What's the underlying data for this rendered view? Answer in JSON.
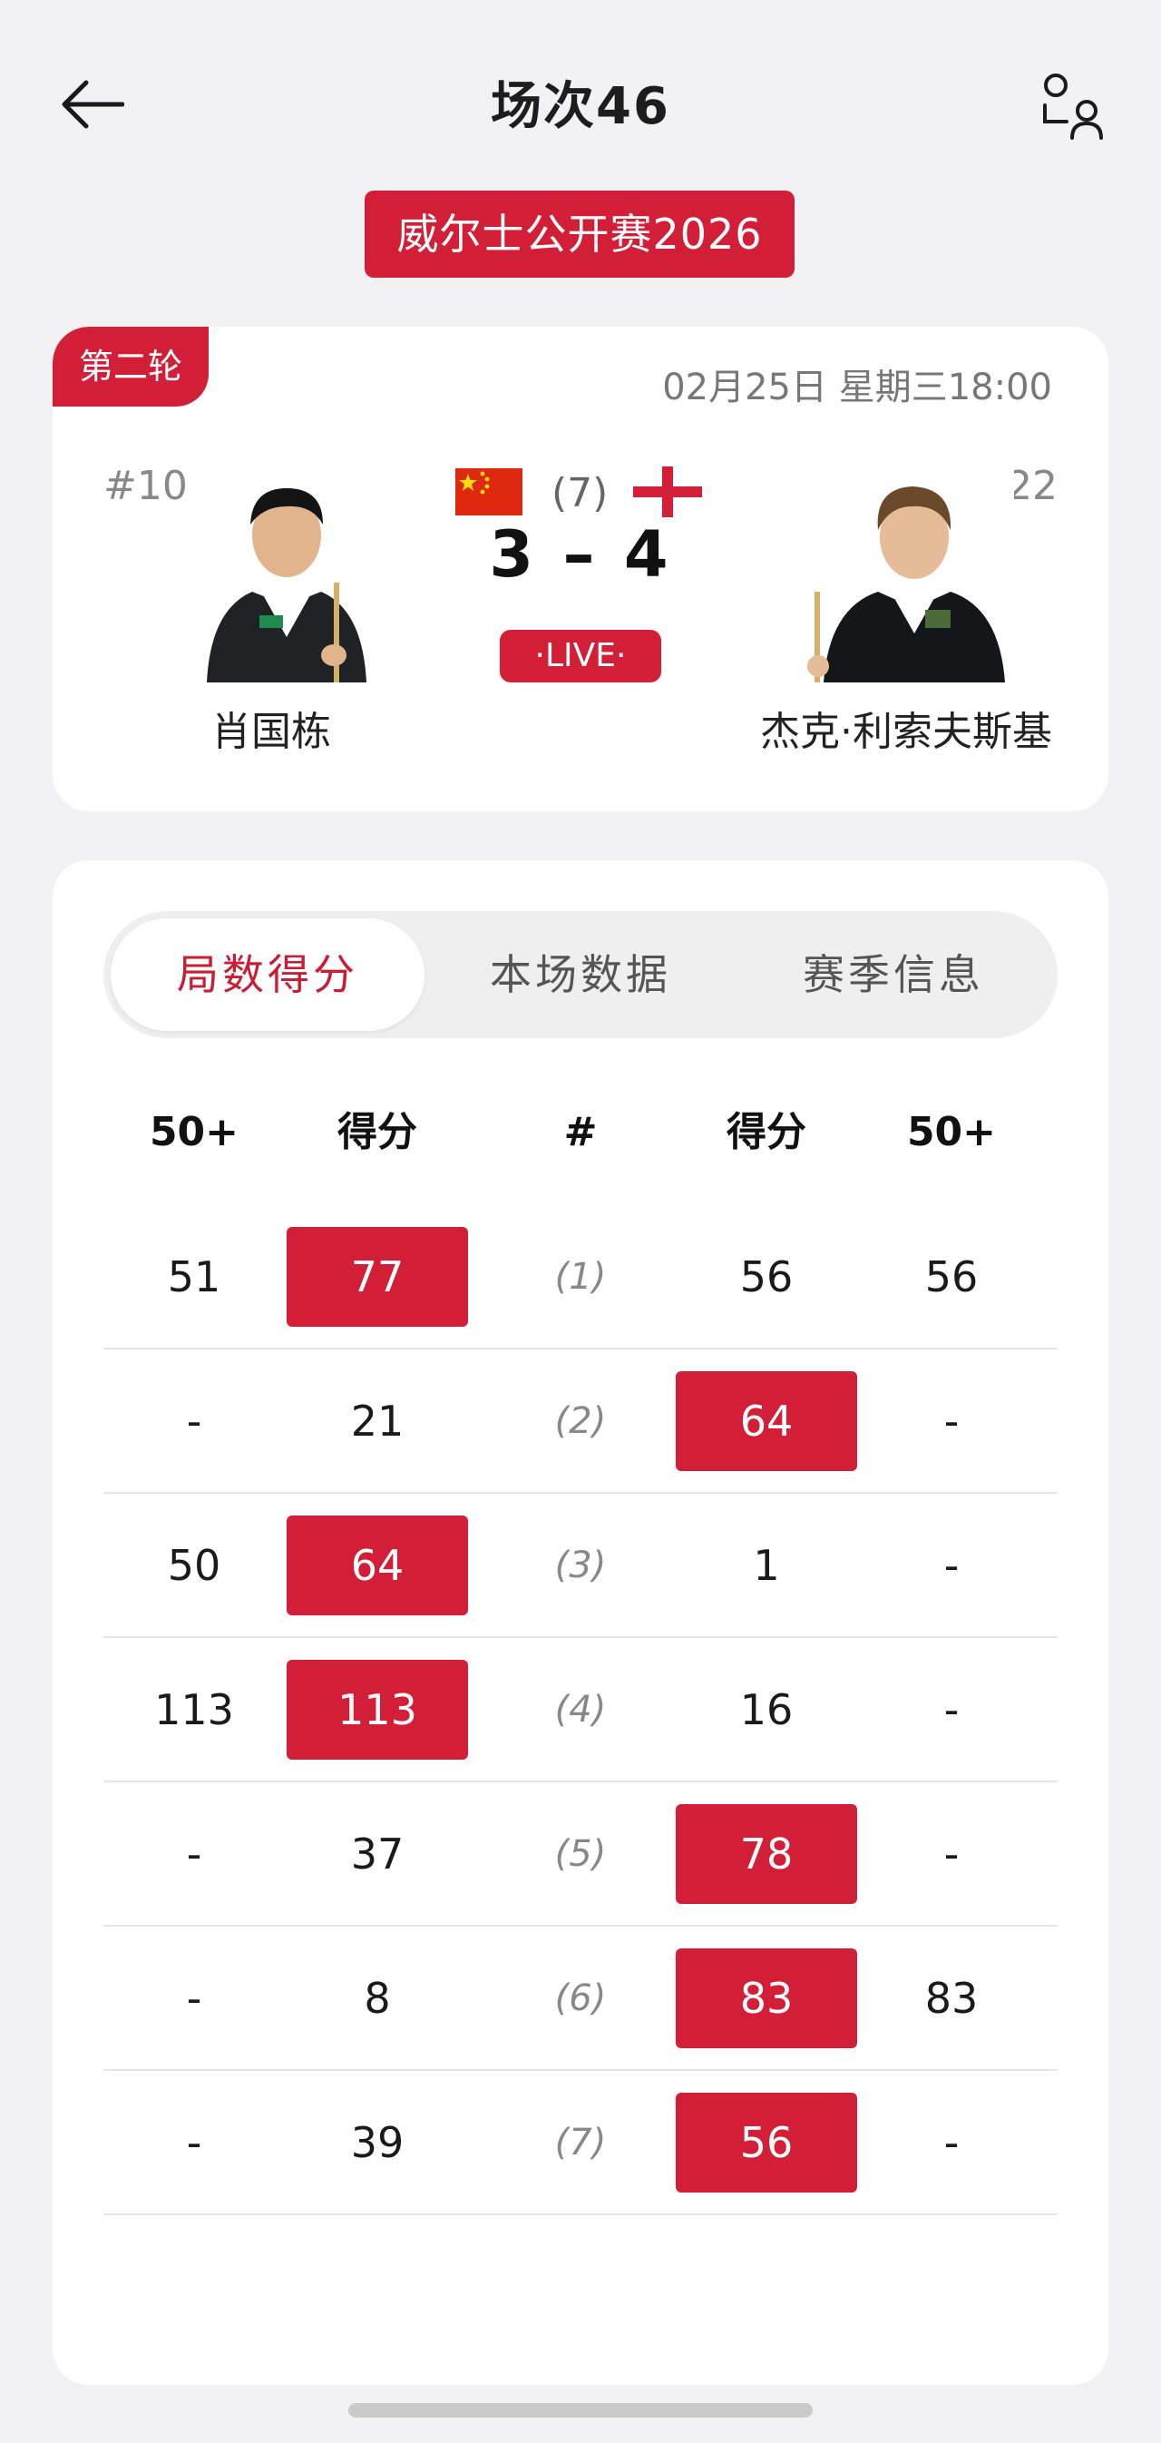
{
  "header": {
    "title": "场次46",
    "back_icon": "arrow-left-icon",
    "players_icon": "two-persons-icon"
  },
  "tournament": "威尔士公开赛2026",
  "match": {
    "round": "第二轮",
    "datetime": "02月25日 星期三18:00",
    "left": {
      "seed": "#10",
      "name": "肖国栋",
      "flag": "china-flag"
    },
    "right": {
      "seed": "#22",
      "name": "杰克·利索夫斯基",
      "flag": "england-flag"
    },
    "best_of": "(7)",
    "score": "3 – 4",
    "status": "·LIVE·"
  },
  "tabs": [
    "局数得分",
    "本场数据",
    "赛季信息"
  ],
  "active_tab": 0,
  "table": {
    "headers": [
      "50+",
      "得分",
      "#",
      "得分",
      "50+"
    ],
    "rows": [
      {
        "l50": "51",
        "lscore": "77",
        "frame": "(1)",
        "rscore": "56",
        "r50": "56",
        "winner": "left"
      },
      {
        "l50": "-",
        "lscore": "21",
        "frame": "(2)",
        "rscore": "64",
        "r50": "-",
        "winner": "right"
      },
      {
        "l50": "50",
        "lscore": "64",
        "frame": "(3)",
        "rscore": "1",
        "r50": "-",
        "winner": "left"
      },
      {
        "l50": "113",
        "lscore": "113",
        "frame": "(4)",
        "rscore": "16",
        "r50": "-",
        "winner": "left"
      },
      {
        "l50": "-",
        "lscore": "37",
        "frame": "(5)",
        "rscore": "78",
        "r50": "-",
        "winner": "right"
      },
      {
        "l50": "-",
        "lscore": "8",
        "frame": "(6)",
        "rscore": "83",
        "r50": "83",
        "winner": "right"
      },
      {
        "l50": "-",
        "lscore": "39",
        "frame": "(7)",
        "rscore": "56",
        "r50": "-",
        "winner": "right"
      }
    ]
  },
  "colors": {
    "accent": "#d31e38",
    "background": "#f2f2f4",
    "card": "#ffffff"
  }
}
